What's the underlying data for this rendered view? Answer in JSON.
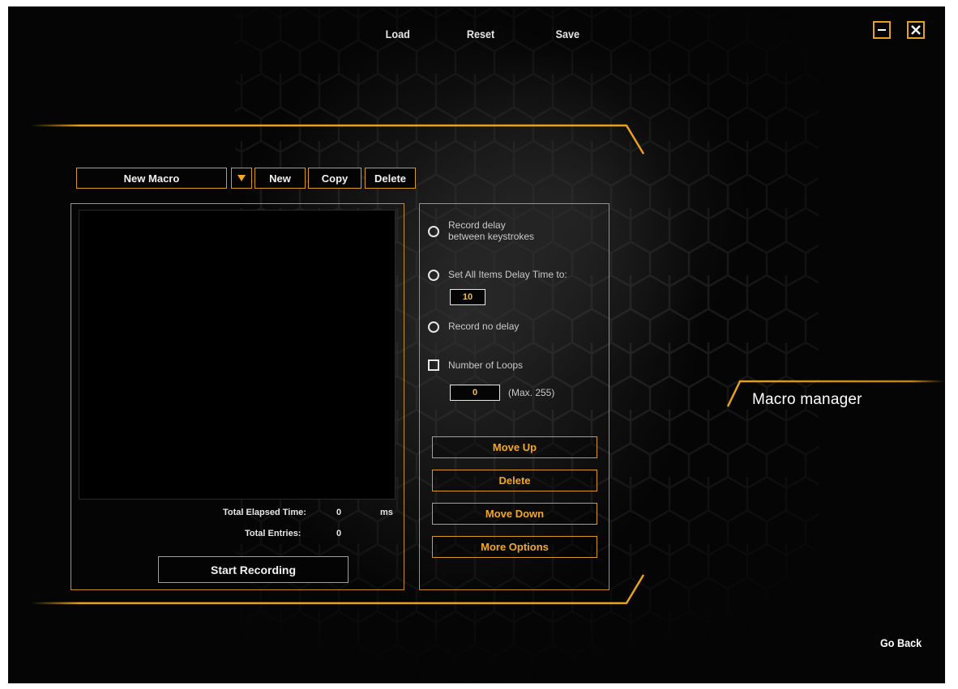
{
  "top_menu": {
    "load": "Load",
    "reset": "Reset",
    "save": "Save"
  },
  "window_controls": {
    "minimize_icon": "minimize-icon",
    "close_icon": "close-icon"
  },
  "section_title": "Macro manager",
  "macro_select": {
    "selected": "New Macro",
    "dropdown_icon": "triangle-down-icon"
  },
  "macro_actions": {
    "new": "New",
    "copy": "Copy",
    "delete": "Delete"
  },
  "recording_panel": {
    "total_elapsed_label": "Total Elapsed Time:",
    "total_elapsed_value": "0",
    "total_elapsed_unit": "ms",
    "total_entries_label": "Total Entries:",
    "total_entries_value": "0",
    "start_recording": "Start Recording"
  },
  "options_panel": {
    "record_delay_line1": "Record delay",
    "record_delay_line2": "between keystrokes",
    "set_all_delay": "Set All Items Delay Time to:",
    "delay_value": "10",
    "record_no_delay": "Record no delay",
    "number_of_loops": "Number of Loops",
    "loops_value": "0",
    "loops_max": "(Max. 255)",
    "move_up": "Move Up",
    "delete": "Delete",
    "move_down": "Move Down",
    "more_options": "More Options"
  },
  "go_back": "Go Back",
  "colors": {
    "accent": "#e8a21c",
    "background": "#050505",
    "text": "#ffffff"
  }
}
